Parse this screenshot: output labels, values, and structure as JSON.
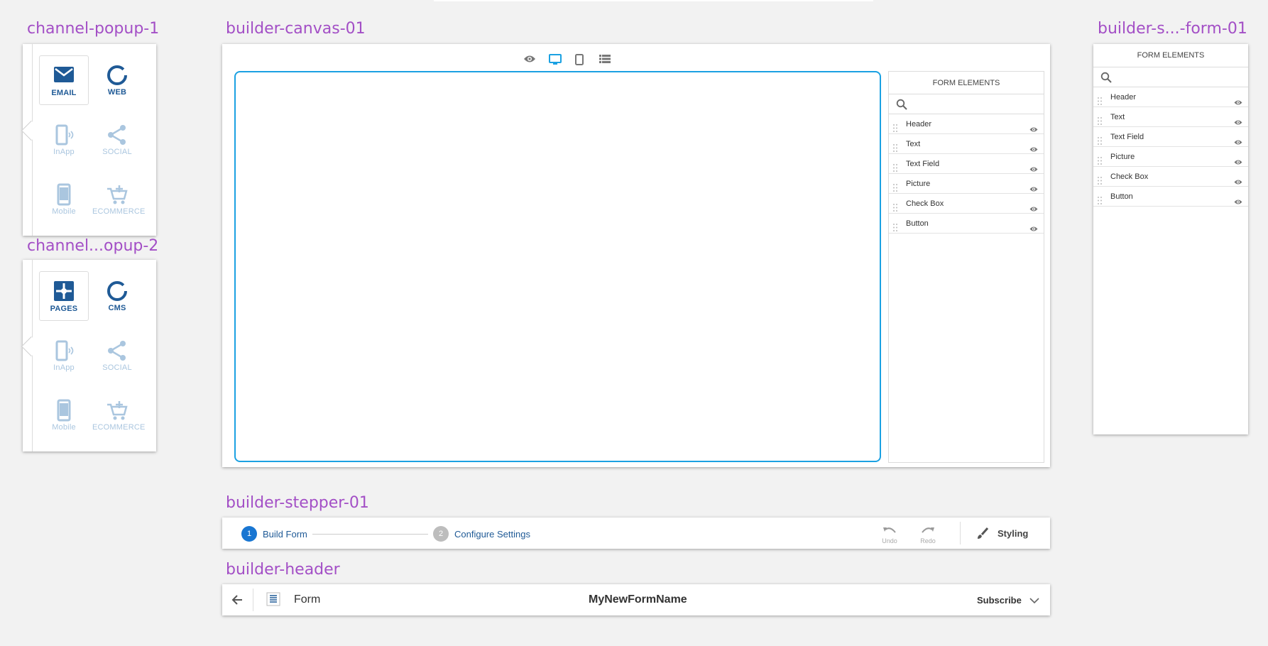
{
  "labels": {
    "popup1": "channel-popup-1",
    "popup2": "channel...opup-2",
    "canvas": "builder-canvas-01",
    "sidebar": "builder-s...-form-01",
    "stepper": "builder-stepper-01",
    "header": "builder-header"
  },
  "popup1": {
    "items": [
      "EMAIL",
      "WEB",
      "InApp",
      "SOCIAL",
      "Mobile",
      "ECOMMERCE"
    ]
  },
  "popup2": {
    "items": [
      "PAGES",
      "CMS",
      "InApp",
      "SOCIAL",
      "Mobile",
      "ECOMMERCE"
    ]
  },
  "form_elements": {
    "title": "FORM ELEMENTS",
    "items": [
      "Header",
      "Text",
      "Text Field",
      "Picture",
      "Check Box",
      "Button"
    ]
  },
  "stepper": {
    "step1_num": "1",
    "step1_label": "Build Form",
    "step2_num": "2",
    "step2_label": "Configure Settings",
    "undo": "Undo",
    "redo": "Redo",
    "styling": "Styling"
  },
  "header": {
    "type": "Form",
    "name": "MyNewFormName",
    "action": "Subscribe"
  },
  "colors": {
    "accent": "#1ba1e2",
    "brand": "#1f5a96",
    "dim_icon": "#aac6df",
    "label": "#a34fc6",
    "step_active": "#1976d2"
  }
}
